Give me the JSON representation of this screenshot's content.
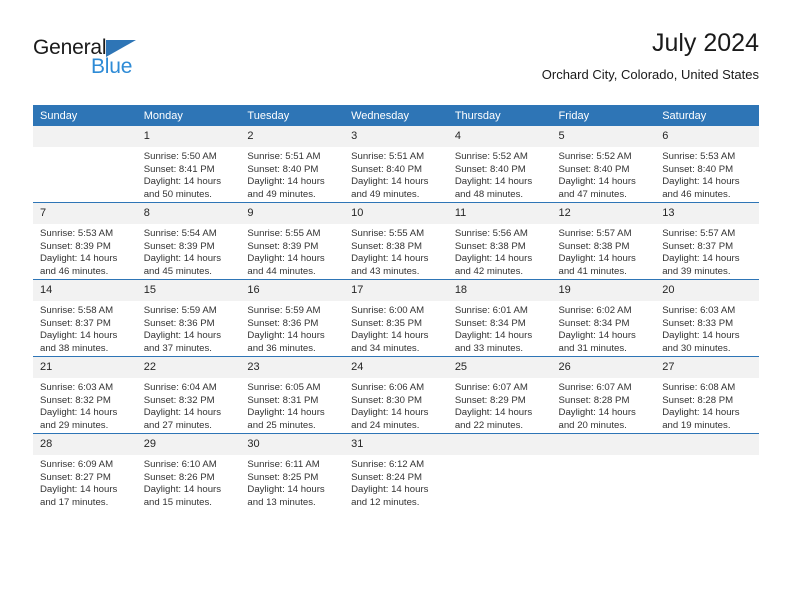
{
  "brand": {
    "name_part1": "General",
    "name_part2": "Blue",
    "triangle_color": "#2E75B6",
    "blue_color": "#2E8BD6"
  },
  "header": {
    "title": "July 2024",
    "subtitle": "Orchard City, Colorado, United States"
  },
  "theme": {
    "header_blue": "#2E75B6",
    "daynum_band": "#F2F2F2",
    "text": "#333333"
  },
  "weekdays": [
    "Sunday",
    "Monday",
    "Tuesday",
    "Wednesday",
    "Thursday",
    "Friday",
    "Saturday"
  ],
  "weeks": [
    [
      {
        "day": "",
        "sunrise": "",
        "sunset": "",
        "daylight": "",
        "empty": true
      },
      {
        "day": "1",
        "sunrise": "Sunrise: 5:50 AM",
        "sunset": "Sunset: 8:41 PM",
        "daylight": "Daylight: 14 hours and 50 minutes."
      },
      {
        "day": "2",
        "sunrise": "Sunrise: 5:51 AM",
        "sunset": "Sunset: 8:40 PM",
        "daylight": "Daylight: 14 hours and 49 minutes."
      },
      {
        "day": "3",
        "sunrise": "Sunrise: 5:51 AM",
        "sunset": "Sunset: 8:40 PM",
        "daylight": "Daylight: 14 hours and 49 minutes."
      },
      {
        "day": "4",
        "sunrise": "Sunrise: 5:52 AM",
        "sunset": "Sunset: 8:40 PM",
        "daylight": "Daylight: 14 hours and 48 minutes."
      },
      {
        "day": "5",
        "sunrise": "Sunrise: 5:52 AM",
        "sunset": "Sunset: 8:40 PM",
        "daylight": "Daylight: 14 hours and 47 minutes."
      },
      {
        "day": "6",
        "sunrise": "Sunrise: 5:53 AM",
        "sunset": "Sunset: 8:40 PM",
        "daylight": "Daylight: 14 hours and 46 minutes."
      }
    ],
    [
      {
        "day": "7",
        "sunrise": "Sunrise: 5:53 AM",
        "sunset": "Sunset: 8:39 PM",
        "daylight": "Daylight: 14 hours and 46 minutes."
      },
      {
        "day": "8",
        "sunrise": "Sunrise: 5:54 AM",
        "sunset": "Sunset: 8:39 PM",
        "daylight": "Daylight: 14 hours and 45 minutes."
      },
      {
        "day": "9",
        "sunrise": "Sunrise: 5:55 AM",
        "sunset": "Sunset: 8:39 PM",
        "daylight": "Daylight: 14 hours and 44 minutes."
      },
      {
        "day": "10",
        "sunrise": "Sunrise: 5:55 AM",
        "sunset": "Sunset: 8:38 PM",
        "daylight": "Daylight: 14 hours and 43 minutes."
      },
      {
        "day": "11",
        "sunrise": "Sunrise: 5:56 AM",
        "sunset": "Sunset: 8:38 PM",
        "daylight": "Daylight: 14 hours and 42 minutes."
      },
      {
        "day": "12",
        "sunrise": "Sunrise: 5:57 AM",
        "sunset": "Sunset: 8:38 PM",
        "daylight": "Daylight: 14 hours and 41 minutes."
      },
      {
        "day": "13",
        "sunrise": "Sunrise: 5:57 AM",
        "sunset": "Sunset: 8:37 PM",
        "daylight": "Daylight: 14 hours and 39 minutes."
      }
    ],
    [
      {
        "day": "14",
        "sunrise": "Sunrise: 5:58 AM",
        "sunset": "Sunset: 8:37 PM",
        "daylight": "Daylight: 14 hours and 38 minutes."
      },
      {
        "day": "15",
        "sunrise": "Sunrise: 5:59 AM",
        "sunset": "Sunset: 8:36 PM",
        "daylight": "Daylight: 14 hours and 37 minutes."
      },
      {
        "day": "16",
        "sunrise": "Sunrise: 5:59 AM",
        "sunset": "Sunset: 8:36 PM",
        "daylight": "Daylight: 14 hours and 36 minutes."
      },
      {
        "day": "17",
        "sunrise": "Sunrise: 6:00 AM",
        "sunset": "Sunset: 8:35 PM",
        "daylight": "Daylight: 14 hours and 34 minutes."
      },
      {
        "day": "18",
        "sunrise": "Sunrise: 6:01 AM",
        "sunset": "Sunset: 8:34 PM",
        "daylight": "Daylight: 14 hours and 33 minutes."
      },
      {
        "day": "19",
        "sunrise": "Sunrise: 6:02 AM",
        "sunset": "Sunset: 8:34 PM",
        "daylight": "Daylight: 14 hours and 31 minutes."
      },
      {
        "day": "20",
        "sunrise": "Sunrise: 6:03 AM",
        "sunset": "Sunset: 8:33 PM",
        "daylight": "Daylight: 14 hours and 30 minutes."
      }
    ],
    [
      {
        "day": "21",
        "sunrise": "Sunrise: 6:03 AM",
        "sunset": "Sunset: 8:32 PM",
        "daylight": "Daylight: 14 hours and 29 minutes."
      },
      {
        "day": "22",
        "sunrise": "Sunrise: 6:04 AM",
        "sunset": "Sunset: 8:32 PM",
        "daylight": "Daylight: 14 hours and 27 minutes."
      },
      {
        "day": "23",
        "sunrise": "Sunrise: 6:05 AM",
        "sunset": "Sunset: 8:31 PM",
        "daylight": "Daylight: 14 hours and 25 minutes."
      },
      {
        "day": "24",
        "sunrise": "Sunrise: 6:06 AM",
        "sunset": "Sunset: 8:30 PM",
        "daylight": "Daylight: 14 hours and 24 minutes."
      },
      {
        "day": "25",
        "sunrise": "Sunrise: 6:07 AM",
        "sunset": "Sunset: 8:29 PM",
        "daylight": "Daylight: 14 hours and 22 minutes."
      },
      {
        "day": "26",
        "sunrise": "Sunrise: 6:07 AM",
        "sunset": "Sunset: 8:28 PM",
        "daylight": "Daylight: 14 hours and 20 minutes."
      },
      {
        "day": "27",
        "sunrise": "Sunrise: 6:08 AM",
        "sunset": "Sunset: 8:28 PM",
        "daylight": "Daylight: 14 hours and 19 minutes."
      }
    ],
    [
      {
        "day": "28",
        "sunrise": "Sunrise: 6:09 AM",
        "sunset": "Sunset: 8:27 PM",
        "daylight": "Daylight: 14 hours and 17 minutes."
      },
      {
        "day": "29",
        "sunrise": "Sunrise: 6:10 AM",
        "sunset": "Sunset: 8:26 PM",
        "daylight": "Daylight: 14 hours and 15 minutes."
      },
      {
        "day": "30",
        "sunrise": "Sunrise: 6:11 AM",
        "sunset": "Sunset: 8:25 PM",
        "daylight": "Daylight: 14 hours and 13 minutes."
      },
      {
        "day": "31",
        "sunrise": "Sunrise: 6:12 AM",
        "sunset": "Sunset: 8:24 PM",
        "daylight": "Daylight: 14 hours and 12 minutes."
      },
      {
        "day": "",
        "sunrise": "",
        "sunset": "",
        "daylight": "",
        "empty": true
      },
      {
        "day": "",
        "sunrise": "",
        "sunset": "",
        "daylight": "",
        "empty": true
      },
      {
        "day": "",
        "sunrise": "",
        "sunset": "",
        "daylight": "",
        "empty": true
      }
    ]
  ]
}
